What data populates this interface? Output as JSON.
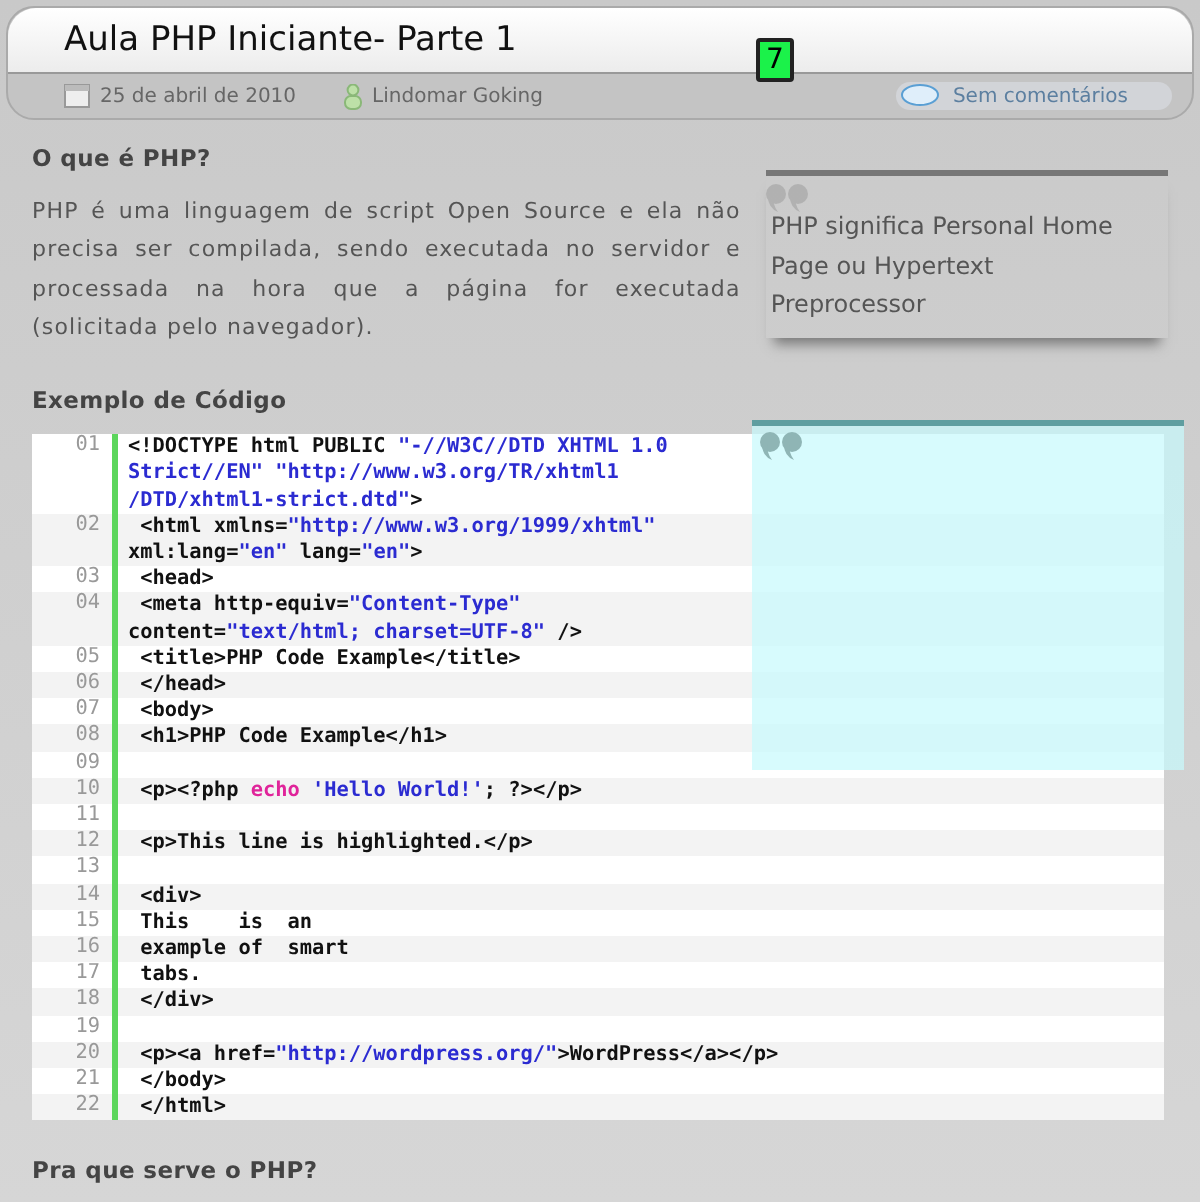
{
  "post": {
    "title": "Aula PHP Iniciante- Parte 1",
    "badge": "7",
    "date": "25 de abril de 2010",
    "author": "Lindomar Goking",
    "comments": "Sem comentários"
  },
  "sections": [
    {
      "heading": "O que é PHP?",
      "paragraph": "PHP é uma linguagem de script Open Source e ela não precisa ser compilada, sendo executada no servidor e processada na hora que a página for executada (solicitada pelo navegador)."
    }
  ],
  "quote": {
    "text": "PHP significa Personal Home Page ou Hypertext Preprocessor"
  },
  "code_heading": "Exemplo de Código",
  "code_lines": [
    {
      "number": "01",
      "rows": [
        {
          "segments": [
            {
              "kind": "plain",
              "text": "<!DOCTYPE html PUBLIC "
            },
            {
              "kind": "string",
              "text": "\"-//W3C//DTD XHTML 1.0"
            }
          ]
        },
        {
          "segments": [
            {
              "kind": "string",
              "text": "Strict//EN\" \"http://www.w3.org/TR/xhtml1"
            }
          ]
        },
        {
          "segments": [
            {
              "kind": "string",
              "text": "/DTD/xhtml1-strict.dtd\""
            },
            {
              "kind": "plain",
              "text": ">"
            }
          ]
        }
      ]
    },
    {
      "number": "02",
      "rows": [
        {
          "segments": [
            {
              "kind": "plain",
              "text": " <html xmlns="
            },
            {
              "kind": "string",
              "text": "\"http://www.w3.org/1999/xhtml\""
            }
          ]
        },
        {
          "segments": [
            {
              "kind": "plain",
              "text": "xml:lang="
            },
            {
              "kind": "string",
              "text": "\"en\""
            },
            {
              "kind": "plain",
              "text": " lang="
            },
            {
              "kind": "string",
              "text": "\"en\""
            },
            {
              "kind": "plain",
              "text": ">"
            }
          ]
        }
      ]
    },
    {
      "number": "03",
      "rows": [
        {
          "segments": [
            {
              "kind": "plain",
              "text": " <head>"
            }
          ]
        }
      ]
    },
    {
      "number": "04",
      "rows": [
        {
          "segments": [
            {
              "kind": "plain",
              "text": " <meta http-equiv="
            },
            {
              "kind": "string",
              "text": "\"Content-Type\""
            }
          ]
        },
        {
          "segments": [
            {
              "kind": "plain",
              "text": "content="
            },
            {
              "kind": "string",
              "text": "\"text/html; charset=UTF-8\""
            },
            {
              "kind": "plain",
              "text": " />"
            }
          ]
        }
      ]
    },
    {
      "number": "05",
      "rows": [
        {
          "segments": [
            {
              "kind": "plain",
              "text": " <title>PHP Code Example</title>"
            }
          ]
        }
      ]
    },
    {
      "number": "06",
      "rows": [
        {
          "segments": [
            {
              "kind": "plain",
              "text": " </head>"
            }
          ]
        }
      ]
    },
    {
      "number": "07",
      "rows": [
        {
          "segments": [
            {
              "kind": "plain",
              "text": " <body>"
            }
          ]
        }
      ]
    },
    {
      "number": "08",
      "rows": [
        {
          "segments": [
            {
              "kind": "plain",
              "text": " <h1>PHP Code Example</h1>"
            }
          ]
        }
      ]
    },
    {
      "number": "09",
      "rows": [
        {
          "segments": []
        }
      ]
    },
    {
      "number": "10",
      "rows": [
        {
          "segments": [
            {
              "kind": "plain",
              "text": " <p><?php "
            },
            {
              "kind": "keyword",
              "text": "echo"
            },
            {
              "kind": "string",
              "text": " 'Hello World!'"
            },
            {
              "kind": "plain",
              "text": "; ?></p>"
            }
          ]
        }
      ]
    },
    {
      "number": "11",
      "rows": [
        {
          "segments": []
        }
      ]
    },
    {
      "number": "12",
      "rows": [
        {
          "segments": [
            {
              "kind": "plain",
              "text": " <p>This line is highlighted.</p>"
            }
          ]
        }
      ]
    },
    {
      "number": "13",
      "rows": [
        {
          "segments": []
        }
      ]
    },
    {
      "number": "14",
      "rows": [
        {
          "segments": [
            {
              "kind": "plain",
              "text": " <div>"
            }
          ]
        }
      ]
    },
    {
      "number": "15",
      "rows": [
        {
          "segments": [
            {
              "kind": "plain",
              "text": " This    is  an"
            }
          ]
        }
      ]
    },
    {
      "number": "16",
      "rows": [
        {
          "segments": [
            {
              "kind": "plain",
              "text": " example of  smart"
            }
          ]
        }
      ]
    },
    {
      "number": "17",
      "rows": [
        {
          "segments": [
            {
              "kind": "plain",
              "text": " tabs."
            }
          ]
        }
      ]
    },
    {
      "number": "18",
      "rows": [
        {
          "segments": [
            {
              "kind": "plain",
              "text": " </div>"
            }
          ]
        }
      ]
    },
    {
      "number": "19",
      "rows": [
        {
          "segments": []
        }
      ]
    },
    {
      "number": "20",
      "rows": [
        {
          "segments": [
            {
              "kind": "plain",
              "text": " <p><a href="
            },
            {
              "kind": "string",
              "text": "\"http://wordpress.org/\""
            },
            {
              "kind": "plain",
              "text": ">WordPress</a></p>"
            }
          ]
        }
      ]
    },
    {
      "number": "21",
      "rows": [
        {
          "segments": [
            {
              "kind": "plain",
              "text": " </body>"
            }
          ]
        }
      ]
    },
    {
      "number": "22",
      "rows": [
        {
          "segments": [
            {
              "kind": "plain",
              "text": " </html>"
            }
          ]
        }
      ]
    }
  ],
  "next_heading": "Pra que serve o PHP?"
}
